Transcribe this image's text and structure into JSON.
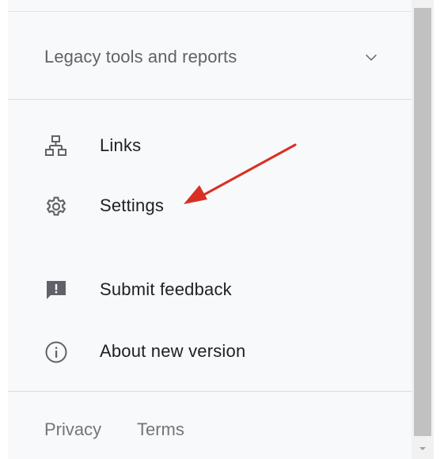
{
  "legacy_section": {
    "label": "Legacy tools and reports",
    "icon": "chevron-down-icon"
  },
  "menu": {
    "items": [
      {
        "label": "Links",
        "icon": "links-icon"
      },
      {
        "label": "Settings",
        "icon": "gear-icon"
      },
      {
        "label": "Submit feedback",
        "icon": "feedback-icon"
      },
      {
        "label": "About new version",
        "icon": "info-icon"
      }
    ]
  },
  "footer": {
    "privacy": "Privacy",
    "terms": "Terms"
  },
  "colors": {
    "panel_bg": "#f8f9fa",
    "text_primary": "#202124",
    "text_secondary": "#5f6368",
    "icon": "#5f6368",
    "annotation_arrow": "#d93025",
    "scrollbar_thumb": "#c1c1c1"
  }
}
